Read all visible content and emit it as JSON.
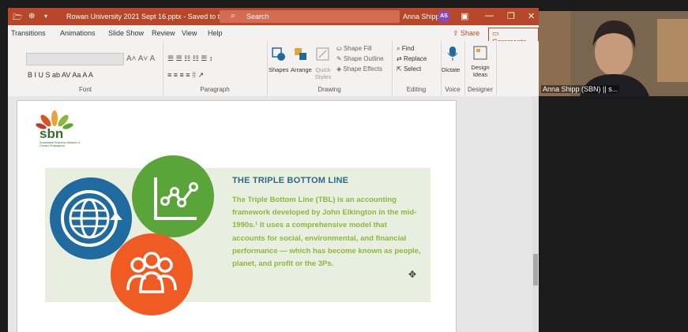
{
  "titlebar": {
    "document": "Rowan University 2021 Sept 16.pptx  -  Saved to this PC",
    "search_placeholder": "Search",
    "user_name": "Anna Shipp",
    "user_initials": "AS"
  },
  "tabs": [
    "Transitions",
    "Animations",
    "Slide Show",
    "Review",
    "View",
    "Help"
  ],
  "share_label": "Share",
  "comments_label": "Comments",
  "ribbon": {
    "font_group": "Font",
    "paragraph_group": "Paragraph",
    "drawing_group": "Drawing",
    "editing_group": "Editing",
    "voice_group": "Voice",
    "designer_group": "Designer",
    "shapes": "Shapes",
    "arrange": "Arrange",
    "quick_styles": "Quick Styles",
    "shape_fill": "Shape Fill",
    "shape_outline": "Shape Outline",
    "shape_effects": "Shape Effects",
    "find": "Find",
    "replace": "Replace",
    "select": "Select",
    "dictate": "Dictate",
    "design_ideas": "Design Ideas"
  },
  "slide": {
    "logo_text": "sbn",
    "logo_subtext": "Sustainable Business Network of Greater Philadelphia",
    "heading": "THE TRIPLE BOTTOM LINE",
    "body": "The Triple Bottom Line (TBL) is an accounting framework developed by John Elkington in the mid-1990s.¹ It uses a comprehensive model that accounts for social, environmental, and financial performance — which has become known as people, planet, and profit or the 3Ps."
  },
  "video": {
    "participant_name": "Anna Shipp (SBN) || s..."
  },
  "colors": {
    "ppt_red": "#b7472a",
    "globe_blue": "#1f6b9f",
    "chart_green": "#5aa53a",
    "people_orange": "#ef5b22",
    "heading_blue": "#2d6987",
    "body_green": "#8bb83a"
  }
}
